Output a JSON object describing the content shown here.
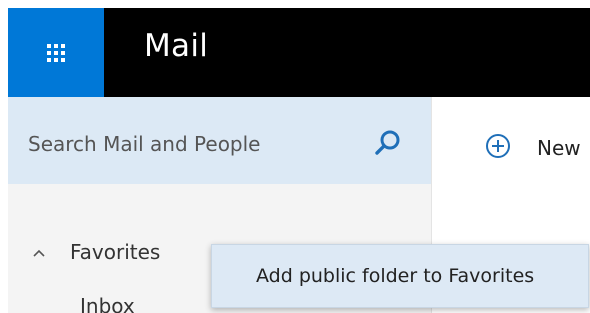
{
  "header": {
    "app_title": "Mail",
    "launcher_icon": "app-launcher-waffle-icon",
    "accent_color": "#0078d7"
  },
  "search": {
    "placeholder": "Search Mail and People",
    "icon": "search-icon"
  },
  "commands": {
    "new_label": "New",
    "new_icon": "plus-circle-icon"
  },
  "folders": {
    "favorites_label": "Favorites",
    "favorites_chevron": "chevron-up-icon",
    "inbox_label": "Inbox"
  },
  "context_menu": {
    "items": [
      {
        "label": "Add public folder to Favorites"
      }
    ]
  }
}
